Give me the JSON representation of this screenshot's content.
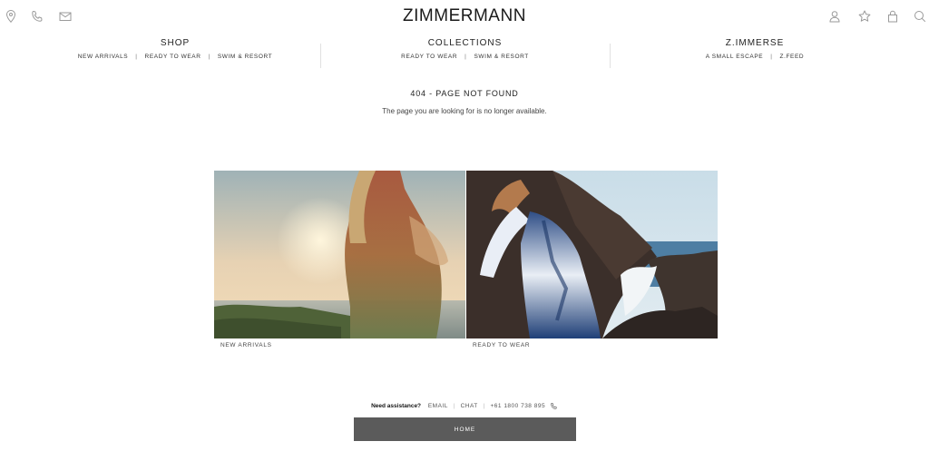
{
  "header": {
    "logo_text": "ZIMMERMANN",
    "left_icons": [
      "location-pin-icon",
      "phone-icon",
      "mail-icon"
    ],
    "right_icons": [
      "account-icon",
      "wishlist-star-icon",
      "bag-lock-icon",
      "search-icon"
    ]
  },
  "nav": {
    "shop": {
      "title": "SHOP",
      "links": [
        "NEW ARRIVALS",
        "READY TO WEAR",
        "SWIM & RESORT"
      ]
    },
    "collections": {
      "title": "COLLECTIONS",
      "links": [
        "READY TO WEAR",
        "SWIM & RESORT"
      ]
    },
    "zimmerse": {
      "title": "Z.IMMERSE",
      "links": [
        "A SMALL ESCAPE",
        "Z.FEED"
      ]
    }
  },
  "error": {
    "title": "404 - PAGE NOT FOUND",
    "message": "The page you are looking for is no longer available."
  },
  "tiles": [
    {
      "caption": "NEW ARRIVALS"
    },
    {
      "caption": "READY TO WEAR"
    }
  ],
  "assistance": {
    "label": "Need assistance?",
    "email": "EMAIL",
    "chat": "CHAT",
    "phone": "+61 1800 738 895"
  },
  "home_button": "HOME",
  "colors": {
    "button_bg": "#5b5b5b",
    "text": "#222222",
    "divider": "#e1e1e1"
  }
}
